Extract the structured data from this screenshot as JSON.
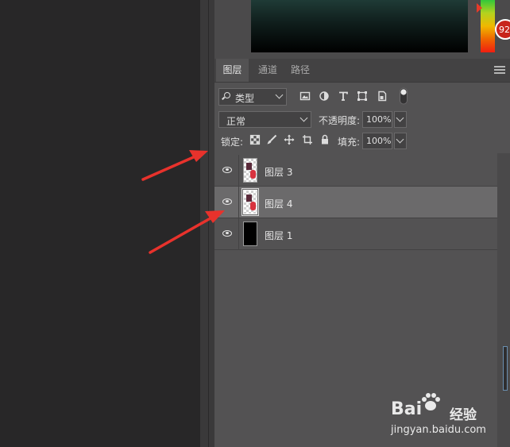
{
  "color_picker": {
    "badge_text": "92"
  },
  "tabs": [
    {
      "label": "图层",
      "active": true
    },
    {
      "label": "通道",
      "active": false
    },
    {
      "label": "路径",
      "active": false
    }
  ],
  "filter": {
    "kind_label": "类型",
    "icons": [
      "image-filter-icon",
      "adjustment-filter-icon",
      "type-filter-icon",
      "shape-filter-icon",
      "smart-object-filter-icon",
      "filter-toggle-icon"
    ]
  },
  "blend_mode": {
    "value": "正常"
  },
  "opacity": {
    "label": "不透明度:",
    "value": "100%"
  },
  "lock": {
    "label": "锁定:",
    "icons": [
      "lock-transparent-pixels-icon",
      "lock-image-pixels-icon",
      "lock-position-icon",
      "lock-artboard-icon",
      "lock-all-icon"
    ]
  },
  "fill": {
    "label": "填充:",
    "value": "100%"
  },
  "layers": [
    {
      "name": "图层 3",
      "selected": false,
      "thumb": "checker"
    },
    {
      "name": "图层 4",
      "selected": true,
      "thumb": "checker"
    },
    {
      "name": "图层 1",
      "selected": false,
      "thumb": "black"
    }
  ],
  "annotation_arrow_color": "#e8322c",
  "watermark": {
    "logo": "Bai",
    "logo_suffix": "经验",
    "url": "jingyan.baidu.com"
  }
}
